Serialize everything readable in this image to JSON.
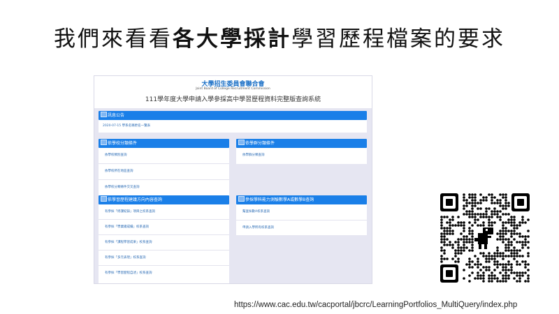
{
  "slide": {
    "title_before": "我們來看看",
    "title_bold": "各大學採計",
    "title_after": "學習歷程檔案的要求",
    "url": "https://www.cac.edu.tw/cacportal/jbcrc/LearningPortfolios_MultiQuery/index.php"
  },
  "site": {
    "org_name": "大學招生委員會聯合會",
    "org_name_en": "Joint Board of College Recruitment Commission",
    "system_title": "111學年度大學申請入學參採高中學習歷程資料完整版查詢系統"
  },
  "panels": {
    "news": {
      "title": "訊息公告",
      "items": [
        "2020-07-15 學系名稱更名一覽表"
      ]
    },
    "school": {
      "title": "依學校分類條件",
      "items": [
        "依學校類別查詢",
        "依學校所在地區查詢",
        "依學校分類條件交叉查詢"
      ]
    },
    "group": {
      "title": "依學群分類條件",
      "items": [
        "依學群分類查詢"
      ]
    },
    "portfolio": {
      "title": "依學習歷程建議方向內容查詢",
      "items": [
        "有參採「修課紀錄」項目之校系查詢",
        "有參採「學業總成績」校系查詢",
        "有參採「課程學習成果」校系查詢",
        "有參採「多元表現」校系查詢",
        "有參採「學習歷程自述」校系查詢"
      ]
    },
    "math": {
      "title": "參採學科能力測驗數學A或數學B查詢",
      "items": [
        "幫查採數A校系查詢",
        "申請入學所有校系查詢"
      ]
    }
  },
  "colors": {
    "panel_header": "#1a7fe8",
    "link": "#2b6cb5",
    "logo_blue": "#1a6fc6",
    "background": "#e6e6f2"
  },
  "icons": {
    "panel_header": "panel-header-icon",
    "qr": "qr-code",
    "dino": "dinosaur-icon"
  }
}
